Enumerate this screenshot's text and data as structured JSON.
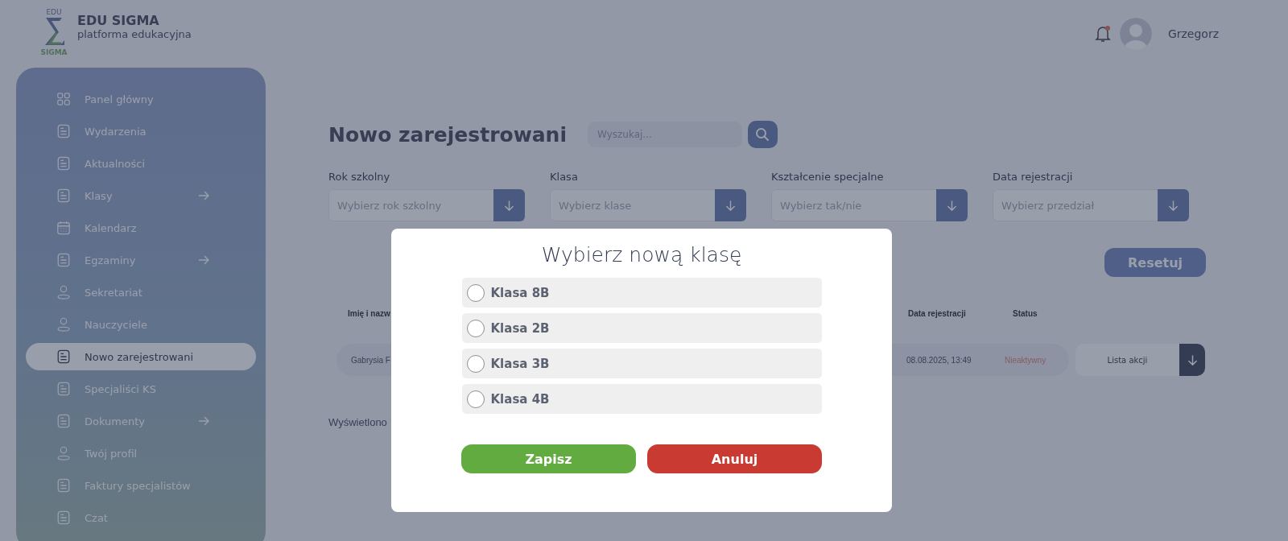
{
  "header": {
    "logo": {
      "top": "EDU",
      "bottom": "SIGMA"
    },
    "brand": "EDU SIGMA",
    "tagline": "platforma edukacyjna",
    "user": "Grzegorz",
    "has_notification": true
  },
  "sidebar": {
    "items": [
      {
        "label": "Panel główny",
        "kind": "grid",
        "selected": false,
        "has_arrow": false
      },
      {
        "label": "Wydarzenia",
        "kind": "doc",
        "selected": false,
        "has_arrow": false
      },
      {
        "label": "Aktualności",
        "kind": "doc",
        "selected": false,
        "has_arrow": false
      },
      {
        "label": "Klasy",
        "kind": "doc",
        "selected": false,
        "has_arrow": true
      },
      {
        "label": "Kalendarz",
        "kind": "calendar",
        "selected": false,
        "has_arrow": false
      },
      {
        "label": "Egzaminy",
        "kind": "doc",
        "selected": false,
        "has_arrow": true
      },
      {
        "label": "Sekretariat",
        "kind": "person",
        "selected": false,
        "has_arrow": false
      },
      {
        "label": "Nauczyciele",
        "kind": "person",
        "selected": false,
        "has_arrow": false
      },
      {
        "label": "Nowo zarejestrowani",
        "kind": "doc",
        "selected": true,
        "has_arrow": false
      },
      {
        "label": "Specjaliści KS",
        "kind": "doc",
        "selected": false,
        "has_arrow": false
      },
      {
        "label": "Dokumenty",
        "kind": "doc",
        "selected": false,
        "has_arrow": true
      },
      {
        "label": "Twój profil",
        "kind": "person",
        "selected": false,
        "has_arrow": false
      },
      {
        "label": "Faktury specjalistów",
        "kind": "doc",
        "selected": false,
        "has_arrow": false
      },
      {
        "label": "Czat",
        "kind": "doc",
        "selected": false,
        "has_arrow": false
      }
    ]
  },
  "main": {
    "title": "Nowo zarejestrowani",
    "search": {
      "placeholder": "Wyszukaj..."
    },
    "filters": [
      {
        "label": "Rok szkolny",
        "placeholder": "Wybierz rok szkolny"
      },
      {
        "label": "Klasa",
        "placeholder": "Wybierz klase"
      },
      {
        "label": "Kształcenie specjalne",
        "placeholder": "Wybierz tak/nie"
      },
      {
        "label": "Data rejestracji",
        "placeholder": "Wybierz przedział"
      }
    ],
    "reset": "Resetuj",
    "table": {
      "columns": [
        "Imię i nazw",
        "Data rejestracji",
        "Status"
      ],
      "rows": [
        {
          "name": "Gabrysia F",
          "date": "08.08.2025, 13:49",
          "status": "Nieaktywny",
          "action": "Lista akcji"
        }
      ]
    },
    "footer": "Wyświetlono"
  },
  "modal": {
    "title": "Wybierz nową klasę",
    "options": [
      {
        "label": "Klasa 8B",
        "selected": false
      },
      {
        "label": "Klasa 2B",
        "selected": false
      },
      {
        "label": "Klasa 3B",
        "selected": false
      },
      {
        "label": "Klasa 4B",
        "selected": false
      }
    ],
    "buttons": [
      {
        "label": "Zapisz",
        "kind": "save"
      },
      {
        "label": "Anuluj",
        "kind": "cancel"
      }
    ]
  }
}
